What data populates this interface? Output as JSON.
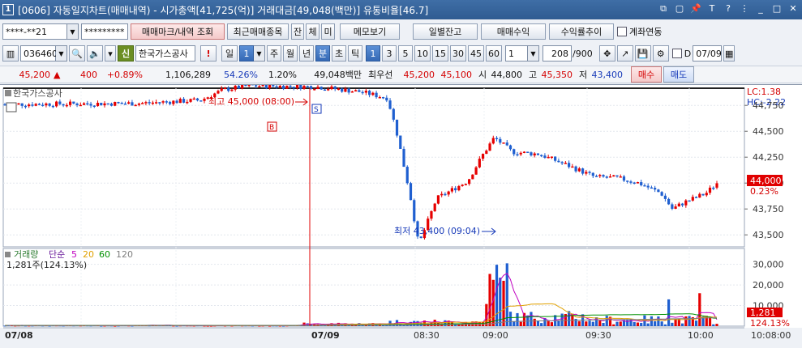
{
  "window": {
    "number": "1",
    "title": "[0606] 자동일지차트(매매내역) - 시가총액[41,725(억)] 거래대금[49,048(백만)] 유통비율[46.7]"
  },
  "toolbar1": {
    "account_value": "****-**21",
    "password_value": "*********",
    "trade_mark_label": "매매마크/내역 조회",
    "recent_label": "최근매매종목",
    "tab_jan": "잔",
    "tab_che": "체",
    "tab_mi": "미",
    "memo_label": "메모보기",
    "daily_balance_label": "일별잔고",
    "trade_profit_label": "매매수익",
    "yield_trend_label": "수익률추이",
    "account_link_label": "계좌연동"
  },
  "toolbar2": {
    "code_value": "036460",
    "credit_badge": "신",
    "stock_name": "한국가스공사",
    "period_buttons": [
      "일",
      "1",
      "주",
      "월",
      "년",
      "분",
      "초",
      "틱"
    ],
    "minute_buttons": [
      "1",
      "3",
      "5",
      "10",
      "15",
      "30",
      "45",
      "60"
    ],
    "unit_value": "1",
    "count_value": "208",
    "count_total": "/900",
    "d_label": "D",
    "date_value": "07/09"
  },
  "quote": {
    "price": "45,200",
    "arrow": "▲",
    "change": "400",
    "change_pct": "+0.89%",
    "volume": "1,106,289",
    "vol_ratio": "54.26%",
    "turnover": "1.20%",
    "amount": "49,048백만",
    "best_label": "최우선",
    "ask": "45,200",
    "bid": "45,100",
    "open_label": "시",
    "open": "44,800",
    "high_label": "고",
    "high": "45,350",
    "low_label": "저",
    "low": "43,400",
    "buy_label": "매수",
    "sell_label": "매도"
  },
  "price_panel": {
    "name": "한국가스공사",
    "lc": "LC:1.38",
    "hc": "HC:-2.22",
    "y_ticks": [
      "44,750",
      "44,500",
      "44,250",
      "44,000",
      "43,750",
      "43,500"
    ],
    "current_price_label": "44,000",
    "current_pct_label": "0.23%",
    "high_annot": "최고 45,000 (08:00)",
    "low_annot": "최저 43,400 (09:04)",
    "buy_marker": "B",
    "sell_marker": "S"
  },
  "volume_panel": {
    "title": "거래량",
    "ma_label": "단순",
    "ma5": "5",
    "ma20": "20",
    "ma60": "60",
    "ma120": "120",
    "info": "1,281주(124.13%)",
    "y_ticks": [
      "30,000",
      "20,000",
      "10,000"
    ],
    "current_volume_label": "1,281",
    "current_pct_label": "124.13%"
  },
  "x_axis": {
    "labels": [
      "07/08",
      "07/09",
      "08:30",
      "09:00",
      "09:30",
      "10:00"
    ],
    "time_label": "10:08:00"
  },
  "colors": {
    "up": "#e60000",
    "down": "#1f5fd0",
    "ma5": "#c000c0",
    "ma20": "#e0a000",
    "ma60": "#009000",
    "ma120": "#7f7f7f"
  },
  "chart_data": {
    "type": "candlestick",
    "price_ylim": [
      43400,
      44900
    ],
    "volume_ylim": [
      0,
      33000
    ],
    "open": 45000,
    "high_of_day": 45000,
    "low_of_day": 43400,
    "last_price": 44000,
    "last_volume": 1281
  }
}
